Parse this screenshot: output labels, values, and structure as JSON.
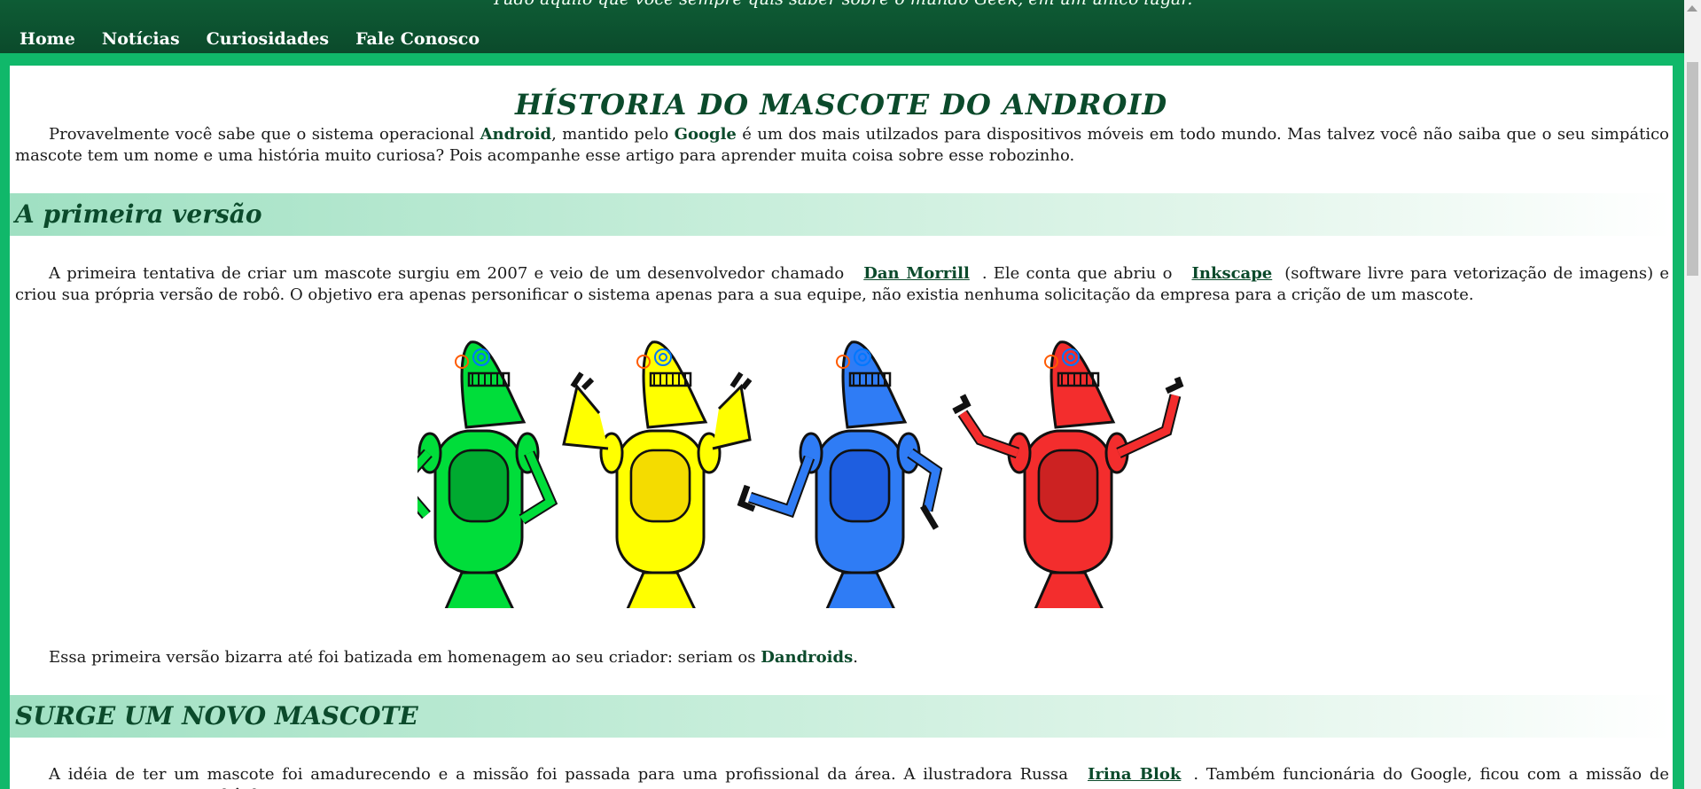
{
  "header": {
    "tagline": "Tudo aquilo que você sempre quis saber sobre o mundo Geek, em um único lugar.",
    "nav": [
      "Home",
      "Notícias",
      "Curiosidades",
      "Fale Conosco"
    ]
  },
  "article": {
    "title": "HÍSTORIA DO MASCOTE DO ANDROID",
    "intro": {
      "t1": "Provavelmente você sabe que o sistema operacional ",
      "b1": "Android",
      "t2": ", mantido pelo ",
      "b2": "Google",
      "t3": " é um dos mais utilzados para dispositivos móveis em todo mundo. Mas talvez você não saiba que o seu simpático mascote tem um nome e uma história muito curiosa? Pois acompanhe esse artigo para aprender muita coisa sobre esse robozinho."
    },
    "section1": {
      "heading": "A primeira versão",
      "p1": {
        "t1": "A primeira tentativa de criar um mascote surgiu em 2007 e veio de um desenvolvedor chamado",
        "link1": "Dan Morrill",
        "t2": ". Ele conta que abriu o",
        "link2": "Inkscape",
        "t3": "(software livre para vetorização de imagens) e criou sua própria versão de robô. O objetivo era apenas personificar o sistema apenas para a sua equipe, não existia nenhuma solicitação da empresa para a crição de um mascote."
      },
      "image_alt": "Dandroids",
      "p2": {
        "t1": "Essa primeira versão bizarra até foi batizada em homenagem ao seu criador: seriam os ",
        "b1": "Dandroids",
        "t2": "."
      }
    },
    "section2": {
      "heading": "SURGE UM NOVO MASCOTE",
      "p1": {
        "t1": "A idéia de ter um mascote foi amadurecendo e a missão foi passada para uma profissional da área. A ilustradora Russa",
        "link1": "Irina Blok",
        "t2": ". Também funcionária do Google, ficou com a missão de representar o pequeno robô de uma"
      }
    }
  },
  "robots": [
    {
      "name": "green",
      "fill": "#00dd3a",
      "dark": "#00aa30"
    },
    {
      "name": "yellow",
      "fill": "#ffff00",
      "dark": "#f4dc00"
    },
    {
      "name": "blue",
      "fill": "#2f7cf5",
      "dark": "#1e5ee0"
    },
    {
      "name": "red",
      "fill": "#f32d2d",
      "dark": "#cc2222"
    }
  ],
  "colors": {
    "header": "#0e5c35",
    "frame": "#10b86a",
    "title": "#0b4a2b",
    "section_start": "#9fe0c2"
  }
}
